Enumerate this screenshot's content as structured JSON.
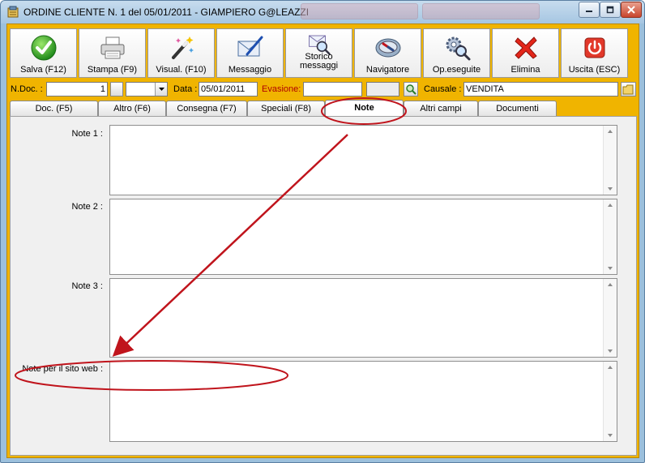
{
  "window": {
    "title": "ORDINE CLIENTE N. 1  del 05/01/2011 - GIAMPIERO G@LEAZZI"
  },
  "toolbar": {
    "buttons": [
      {
        "label": "Salva (F12)",
        "icon": "check-icon"
      },
      {
        "label": "Stampa (F9)",
        "icon": "printer-icon"
      },
      {
        "label": "Visual. (F10)",
        "icon": "magic-wand-icon"
      },
      {
        "label": "Messaggio",
        "icon": "envelope-pen-icon"
      },
      {
        "label": "Storico messaggi",
        "icon": "envelope-search-icon"
      },
      {
        "label": "Navigatore",
        "icon": "compass-icon"
      },
      {
        "label": "Op.eseguite",
        "icon": "gears-search-icon"
      },
      {
        "label": "Elimina",
        "icon": "red-x-icon"
      },
      {
        "label": "Uscita (ESC)",
        "icon": "power-icon"
      }
    ]
  },
  "fields": {
    "ndoc_label": "N.Doc. :",
    "ndoc_value": "1",
    "data_label": "Data :",
    "data_value": "05/01/2011",
    "evasione_label": "Evasione:",
    "evasione_value": "",
    "causale_label": "Causale :",
    "causale_value": "VENDITA"
  },
  "tabs": [
    {
      "label": "Doc. (F5)"
    },
    {
      "label": "Altro (F6)"
    },
    {
      "label": "Consegna (F7)"
    },
    {
      "label": "Speciali (F8)"
    },
    {
      "label": "Note",
      "active": true
    },
    {
      "label": "Altri campi"
    },
    {
      "label": "Documenti"
    }
  ],
  "notes": [
    {
      "label": "Note 1 :",
      "value": ""
    },
    {
      "label": "Note 2 :",
      "value": ""
    },
    {
      "label": "Note 3 :",
      "value": ""
    },
    {
      "label": "Note per il sito web :",
      "value": ""
    }
  ],
  "colors": {
    "accent": "#f0b400",
    "annotation": "#c0141c"
  }
}
